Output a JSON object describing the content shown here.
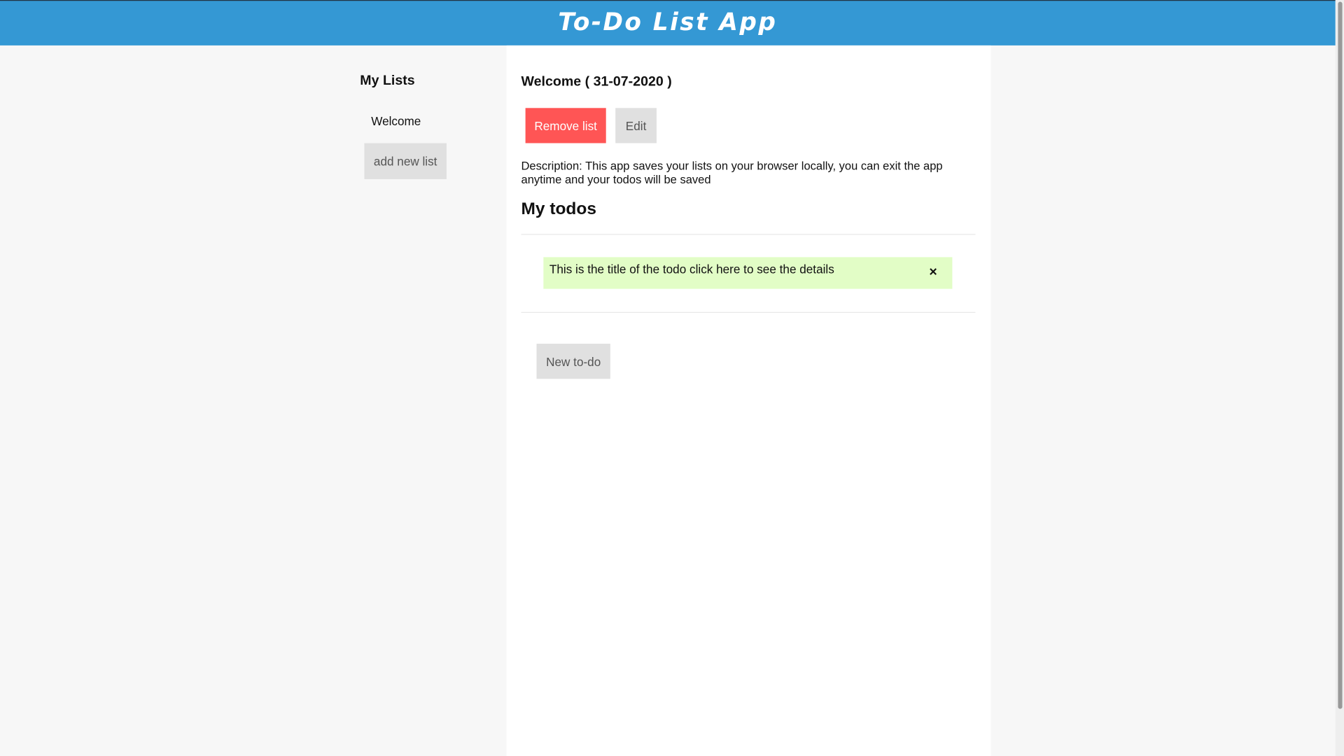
{
  "header": {
    "title": "To-Do List App"
  },
  "sidebar": {
    "title": "My Lists",
    "lists": [
      {
        "label": "Welcome"
      }
    ],
    "add_label": "add new list"
  },
  "main": {
    "list_title": "Welcome ( 31-07-2020 )",
    "remove_label": "Remove list",
    "edit_label": "Edit",
    "description": "Description: This app saves your lists on your browser locally, you can exit the app anytime and your todos will be saved",
    "todos_heading": "My todos",
    "todos": [
      {
        "title": "This is the title of the todo click here to see the details",
        "close": "×"
      }
    ],
    "new_todo_label": "New to-do"
  },
  "colors": {
    "header": "#3498d4",
    "remove": "#ff5555",
    "todo_bg": "#e2fdc6"
  }
}
